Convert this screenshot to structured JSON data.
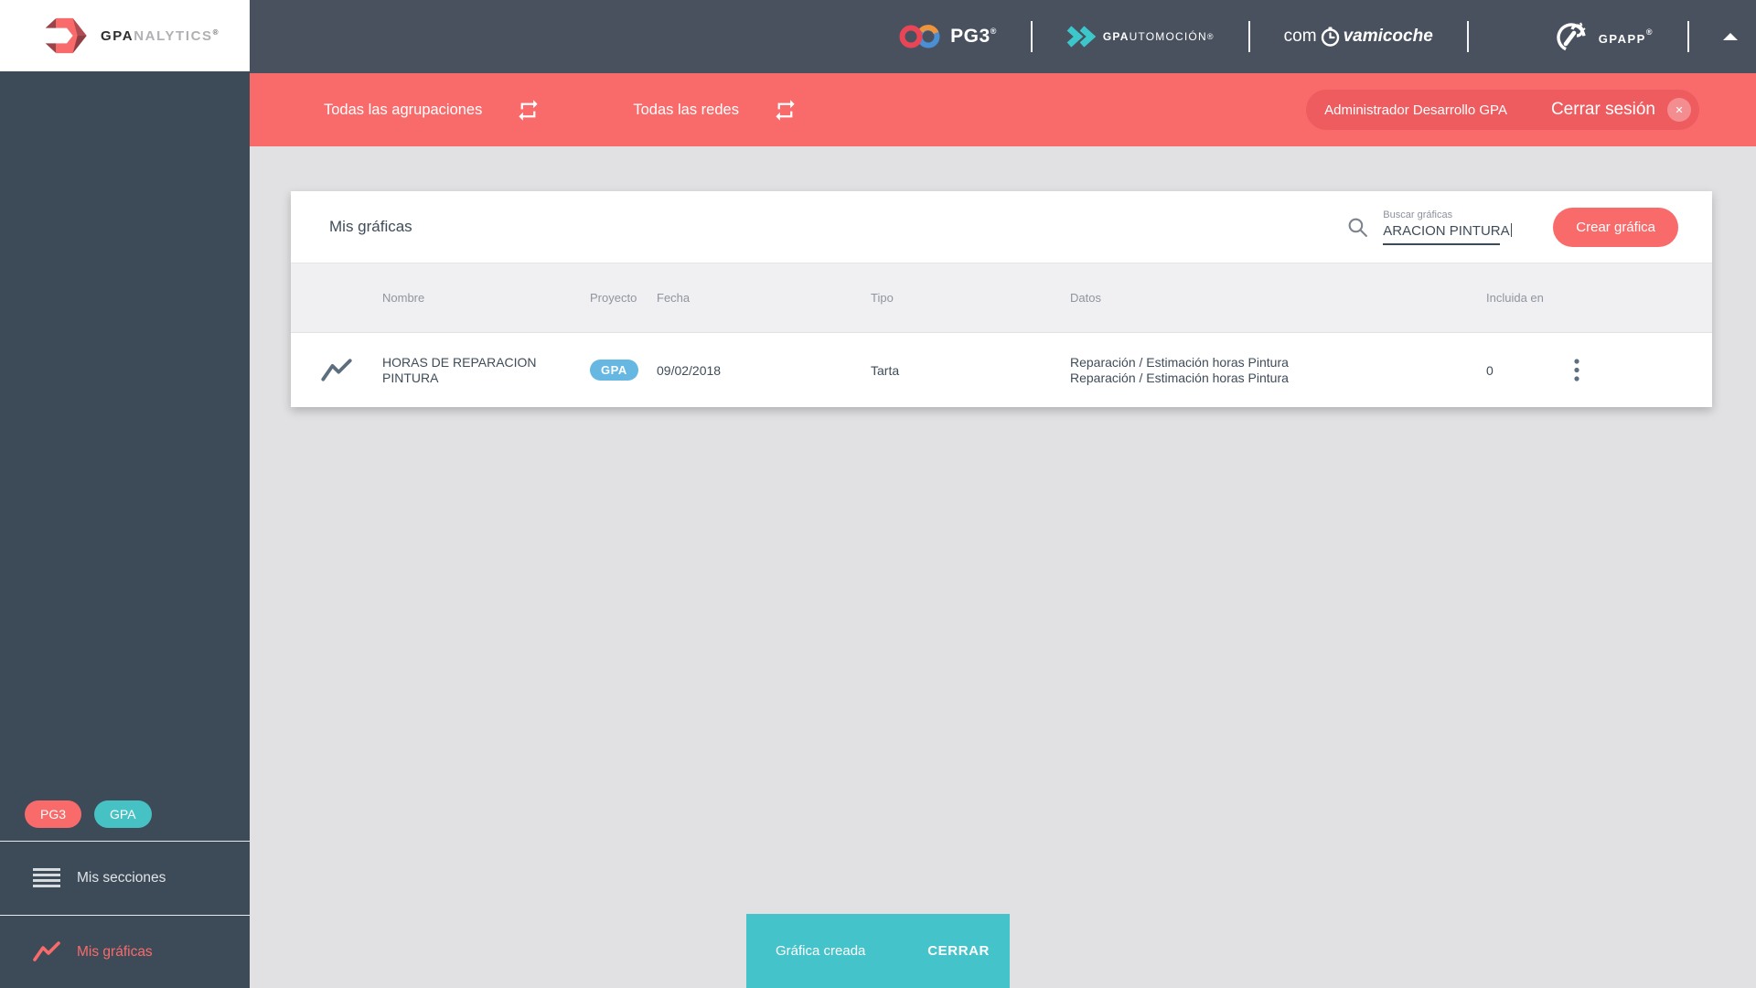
{
  "brand": {
    "analytics": {
      "gpa": "GPA",
      "nalytics": "NALYTICS",
      "reg": "®"
    },
    "pg3": {
      "label": "PG3",
      "reg": "®"
    },
    "automocion": {
      "gpa": "GPA",
      "rest": "UTOMOCIÓN",
      "reg": "®"
    },
    "comvamicoche": {
      "pre": "com",
      "post": "vamicoche"
    },
    "gpapp": {
      "label": "GPAPP",
      "reg": "®"
    }
  },
  "filterbar": {
    "groups_label": "Todas las agrupaciones",
    "networks_label": "Todas las redes",
    "user_chip": "Administrador Desarrollo GPA",
    "logout_label": "Cerrar sesión",
    "logout_icon": "✕"
  },
  "sidebar": {
    "badges": [
      {
        "label": "PG3",
        "color": "#f96b6b"
      },
      {
        "label": "GPA",
        "color": "#47c2c4"
      }
    ],
    "items": [
      {
        "label": "Mis secciones",
        "icon": "menu-icon"
      },
      {
        "label": "Mis gráficas",
        "icon": "line-chart-icon",
        "active": true
      }
    ]
  },
  "card": {
    "title": "Mis gráficas",
    "search": {
      "label": "Buscar gráficas",
      "value": "ARACION PINTURA"
    },
    "create_button": "Crear gráfica"
  },
  "table": {
    "headers": [
      "Nombre",
      "Proyecto",
      "Fecha",
      "Tipo",
      "Datos",
      "Incluida en"
    ],
    "rows": [
      {
        "name_line1": "HORAS DE REPARACION",
        "name_line2": "PINTURA",
        "project_badge": "GPA",
        "date": "09/02/2018",
        "type": "Tarta",
        "data_line1": "Reparación / Estimación horas Pintura",
        "data_line2": "Reparación / Estimación horas Pintura",
        "included_in": "0"
      }
    ]
  },
  "toast": {
    "message": "Gráfica creada",
    "action": "CERRAR"
  },
  "icons": [
    "gpa-arrow-logo-icon",
    "pg3-infinity-icon",
    "automocion-arrows-icon",
    "clock-icon",
    "gpapp-wrench-icon",
    "collapse-up-icon",
    "repeat-icon",
    "power-icon",
    "search-icon",
    "line-chart-icon",
    "menu-icon",
    "kebab-menu-icon"
  ],
  "colors": {
    "accent_red": "#f96b6b",
    "accent_red_dark": "#ee5c5f",
    "toast_teal": "#45c3cb",
    "badge_teal": "#47c2c4",
    "badge_blue": "#66b7e2",
    "header_dark": "#49515f",
    "sidebar_dark": "#3d4b58",
    "page_bg": "#e1e1e4",
    "table_header_bg": "#f0f0f2"
  }
}
